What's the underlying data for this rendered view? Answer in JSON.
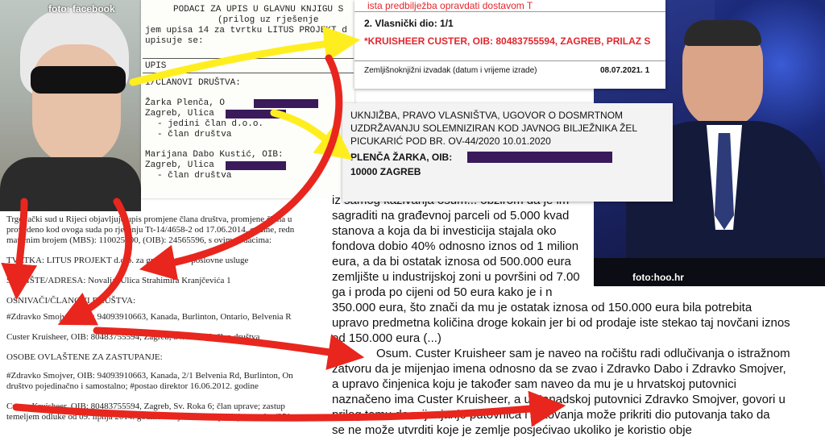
{
  "credits": {
    "left": "foto: facebook",
    "right": "foto:hoo.hr"
  },
  "doc_type": {
    "lines": [
      "PODACI ZA UPIS U GLAVNU KNJIGU S",
      "(prilog uz rješenje",
      "jem upisa 14 za tvrtku LITUS PROJEKT d",
      "upisuje se:",
      "UPIS",
      "1/ČLANOVI DRUŠTVA:",
      "Žarka Plenča, O",
      "Zagreb, Ulica",
      "- jedini član d.o.o.",
      "- član društva",
      "Marijana Dabo Kustić, OIB:",
      "Zagreb, Ulica",
      "- član društva"
    ]
  },
  "land1": {
    "red_header": "ista predbilježba opravdati dostavom T",
    "ownership": "2. Vlasnički dio: 1/1",
    "owner_line": "*KRUISHEER CUSTER, OIB: 80483755594, ZAGREB, PRILAZ S",
    "extract_label": "Zemljišnoknjižni izvadak (datum i vrijeme izrade)",
    "extract_date": "08.07.2021. 1"
  },
  "land2": {
    "lines": [
      "UKNJIŽBA, PRAVO VLASNIŠTVA, UGOVOR O DOSMRTNOM",
      "UZDRŽAVANJU SOLEMNIZIRAN KOD JAVNOG BILJEŽNIKA ŽEL",
      "PICUKARIĆ POD BR. OV-44/2020 10.01.2020"
    ],
    "owner": "PLENČA ŽARKA, OIB:",
    "city": "10000 ZAGREB"
  },
  "doc_left": {
    "lines": [
      "Trgovački sud u Rijeci objavljuje upis promjene člana društva, promjene člana u",
      "provedeno kod ovoga suda po rješenju Tt-14/4658-2 od 17.06.2014. godine, redn",
      "matičnim brojem (MBS): 110025300, (OIB): 24565596, s ovim podacima:",
      "TVRTKA: LITUS PROJEKT d.o.o. za građevinske poslovne usluge",
      "SJEDIŠTE/ADRESA: Novalja, Ulica Strahimira Kranjčevića 1",
      "OSNIVAČI/ČLANOVI DRUŠTVA:",
      "#Zdravko Smojver, OIB: 94093910663, Kanada, Burlinton, Ontario, Belvenia R",
      "Custer Kruisheer, OIB: 80483755594, Zagreb, Sv. Roka 6; član društva",
      "OSOBE OVLAŠTENE ZA ZASTUPANJE:",
      "#Zdravko Smojver, OIB: 94093910663, Kanada, 2/1 Belvenia Rd, Burlinton, On",
      "društvo pojedinačno i samostalno; #postao direktor 16.06.2012. godine",
      "Custer Kruisheer, OIB: 80483755594, Zagreb, Sv. Roka 6; član uprave; zastup",
      "temeljem odluke od 09. lipnja 2014. godine s kojim danom počinje mandat (251"
    ]
  },
  "article": {
    "lines": [
      "iz samog kazivanja osum... obzirom da je im",
      "sagraditi na građevnoj parceli od 5.000 kvad",
      "stanova a koja da bi investicija stajala oko",
      "fondova dobio 40% odnosno iznos od 1 milion",
      "eura, a da bi ostatak iznosa od 500.000 eura",
      "zemljište u industrijskoj zoni u površini od 7.00",
      "ga i proda po cijeni od 50 eura kako je i n",
      "350.000 eura, što znači da mu je ostatak iznosa od 150.000 eura bila potrebita",
      "upravo predmetna količina droge kokain jer bi od prodaje iste stekao taj novčani iznos",
      "od 150.000 eura (...)",
      "Osum. Custer Kruisheer sam je naveo na ročištu radi odlučivanja o istražnom",
      "zatvoru da je mijenjao imena odnosno da se zvao i Zdravko Dabo i Zdravko Smojver,",
      "a upravo činjenica koju je također sam naveo da mu je u hrvatskoj putovnici",
      "naznačeno ima Custer Kruisheer, a u Kanadskoj putovnici Zdravko Smojver, govori u",
      "prilog tomu da mijenjanje putovnica i putovanja može prikriti dio putovanja tako da",
      "se ne može utvrditi koje je zemlje posjećivao ukoliko je koristio obje"
    ]
  },
  "colors": {
    "red_arrow": "#e8261e",
    "yellow_arrow": "#ffee1f",
    "redaction": "#3a1a5a",
    "red_text": "#e3262d"
  }
}
